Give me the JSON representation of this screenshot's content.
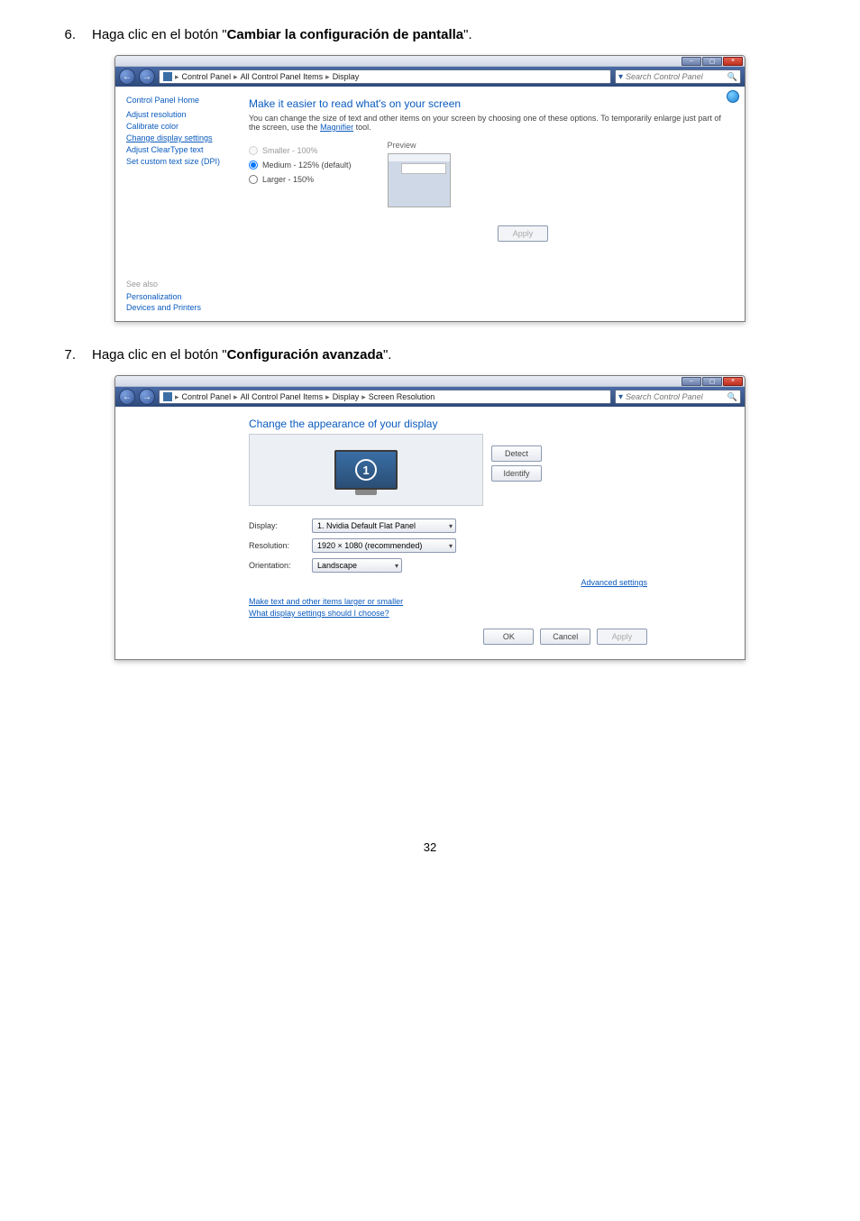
{
  "step6": {
    "num": "6.",
    "prefix": "Haga clic en el botón \"",
    "bold": "Cambiar la configuración de pantalla",
    "suffix": "\"."
  },
  "step7": {
    "num": "7.",
    "prefix": "Haga clic en el botón \"",
    "bold": "Configuración avanzada",
    "suffix": "\"."
  },
  "win_common": {
    "search_placeholder": "Search Control Panel"
  },
  "win1": {
    "breadcrumb": {
      "a": "Control Panel",
      "b": "All Control Panel Items",
      "c": "Display"
    },
    "sidebar": {
      "home": "Control Panel Home",
      "items": [
        "Adjust resolution",
        "Calibrate color",
        "Change display settings",
        "Adjust ClearType text",
        "Set custom text size (DPI)"
      ],
      "see_also": "See also",
      "see_items": [
        "Personalization",
        "Devices and Printers"
      ]
    },
    "content": {
      "heading": "Make it easier to read what's on your screen",
      "desc0": "You can change the size of text and other items on your screen by choosing one of these options. To temporarily enlarge just part of the screen, use the ",
      "desc_link": "Magnifier",
      "desc1": " tool.",
      "opt_small": "Smaller - 100%",
      "opt_med": "Medium - 125% (default)",
      "opt_large": "Larger - 150%",
      "preview": "Preview",
      "apply": "Apply"
    }
  },
  "win2": {
    "breadcrumb": {
      "a": "Control Panel",
      "b": "All Control Panel Items",
      "c": "Display",
      "d": "Screen Resolution"
    },
    "content": {
      "heading": "Change the appearance of your display",
      "detect": "Detect",
      "identify": "Identify",
      "display_lbl": "Display:",
      "display_val": "1. Nvidia Default Flat Panel",
      "res_lbl": "Resolution:",
      "res_val": "1920 × 1080 (recommended)",
      "ori_lbl": "Orientation:",
      "ori_val": "Landscape",
      "adv": "Advanced settings",
      "link1": "Make text and other items larger or smaller",
      "link2": "What display settings should I choose?",
      "ok": "OK",
      "cancel": "Cancel",
      "apply": "Apply"
    }
  },
  "page_number": "32"
}
